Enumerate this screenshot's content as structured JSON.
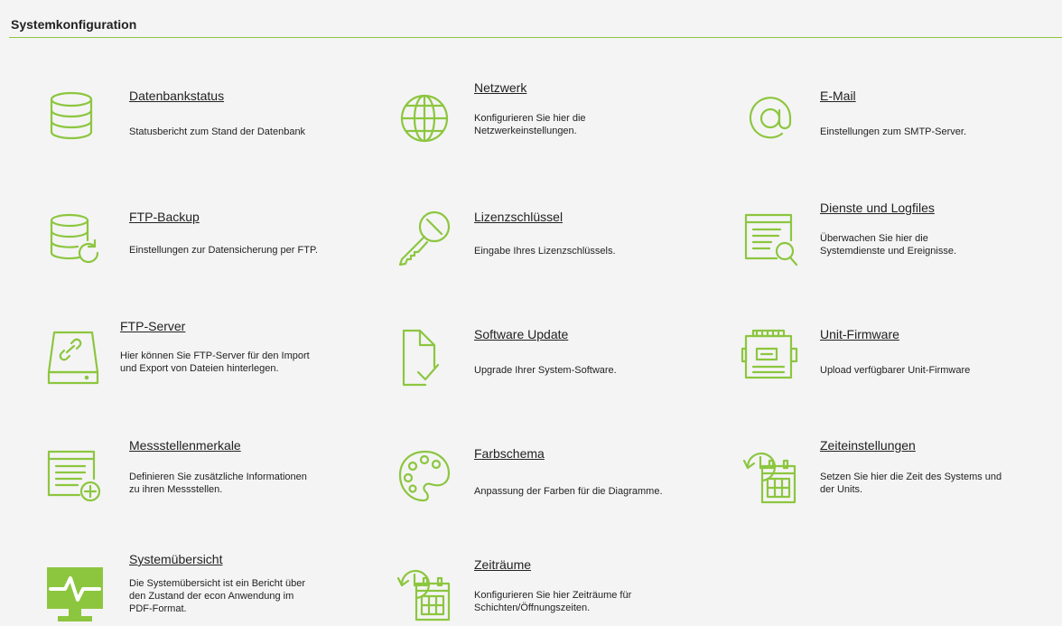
{
  "header": {
    "title": "Systemkonfiguration"
  },
  "accent_color": "#8cc63f",
  "tiles": [
    {
      "id": "datenbankstatus",
      "icon": "database-icon",
      "title": "Datenbankstatus",
      "desc": [
        "Statusbericht zum Stand der Datenbank"
      ]
    },
    {
      "id": "netzwerk",
      "icon": "globe-icon",
      "title": "Netzwerk",
      "desc": [
        "Konfigurieren Sie hier die",
        "Netzwerkeinstellungen."
      ]
    },
    {
      "id": "email",
      "icon": "at-sign-icon",
      "title": "E-Mail",
      "desc": [
        "Einstellungen zum SMTP-Server."
      ]
    },
    {
      "id": "ftp-backup",
      "icon": "database-refresh-icon",
      "title": "FTP-Backup",
      "desc": [
        "Einstellungen zur Datensicherung per FTP."
      ]
    },
    {
      "id": "lizenzschluessel",
      "icon": "key-icon",
      "title": "Lizenzschlüssel",
      "desc": [
        "Eingabe Ihres Lizenzschlüssels."
      ]
    },
    {
      "id": "dienste-logfiles",
      "icon": "log-search-icon",
      "title": "Dienste und Logfiles",
      "desc": [
        "Überwachen Sie hier die",
        "Systemdienste und Ereignisse."
      ]
    },
    {
      "id": "ftp-server",
      "icon": "server-link-icon",
      "title": "FTP-Server",
      "desc": [
        "Hier können Sie FTP-Server für den Import",
        "und Export von Dateien hinterlegen."
      ]
    },
    {
      "id": "software-update",
      "icon": "document-check-icon",
      "title": "Software Update",
      "desc": [
        "Upgrade Ihrer System-Software."
      ]
    },
    {
      "id": "unit-firmware",
      "icon": "device-unit-icon",
      "title": "Unit-Firmware",
      "desc": [
        "Upload verfügbarer Unit-Firmware"
      ]
    },
    {
      "id": "messstellenmerkale",
      "icon": "list-add-icon",
      "title": "Messstellenmerkale",
      "desc": [
        "Definieren Sie zusätzliche Informationen",
        "zu ihren Messstellen."
      ]
    },
    {
      "id": "farbschema",
      "icon": "palette-icon",
      "title": "Farbschema",
      "desc": [
        "Anpassung der Farben für die Diagramme."
      ]
    },
    {
      "id": "zeiteinstellungen",
      "icon": "clock-calendar-icon",
      "title": "Zeiteinstellungen",
      "desc": [
        "Setzen Sie hier die Zeit des Systems und",
        "der Units."
      ]
    },
    {
      "id": "systemuebersicht",
      "icon": "monitor-pulse-icon",
      "title": "Systemübersicht",
      "desc": [
        "Die Systemübersicht ist ein Bericht über",
        "den Zustand der econ Anwendung im",
        "PDF-Format."
      ]
    },
    {
      "id": "zeitraeume",
      "icon": "clock-calendar-icon",
      "title": "Zeiträume",
      "desc": [
        "Konfigurieren Sie hier Zeiträume für",
        "Schichten/Öffnungszeiten."
      ]
    }
  ]
}
